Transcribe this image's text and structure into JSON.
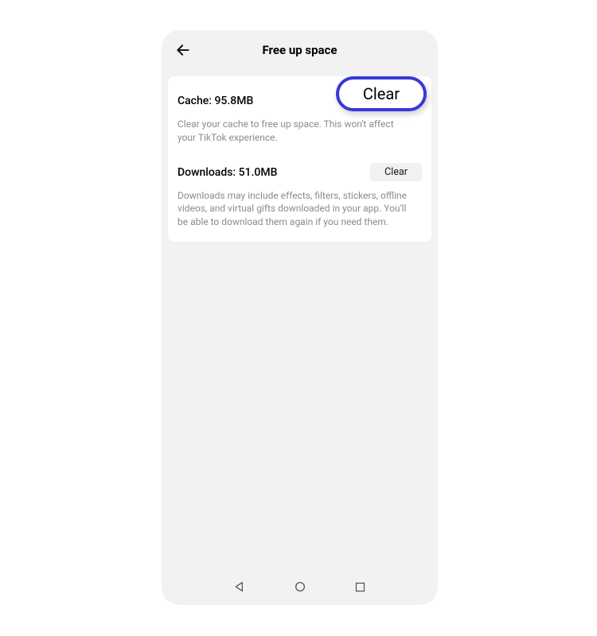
{
  "header": {
    "title": "Free up space"
  },
  "sections": {
    "cache": {
      "label": "Cache: 95.8MB",
      "button": "Clear",
      "description": "Clear your cache to free up space. This won't affect your TikTok experience."
    },
    "downloads": {
      "label": "Downloads: 51.0MB",
      "button": "Clear",
      "description": "Downloads may include effects, filters, stickers, offline videos, and virtual gifts downloaded in your app. You'll be able to download them again if you need them."
    }
  }
}
